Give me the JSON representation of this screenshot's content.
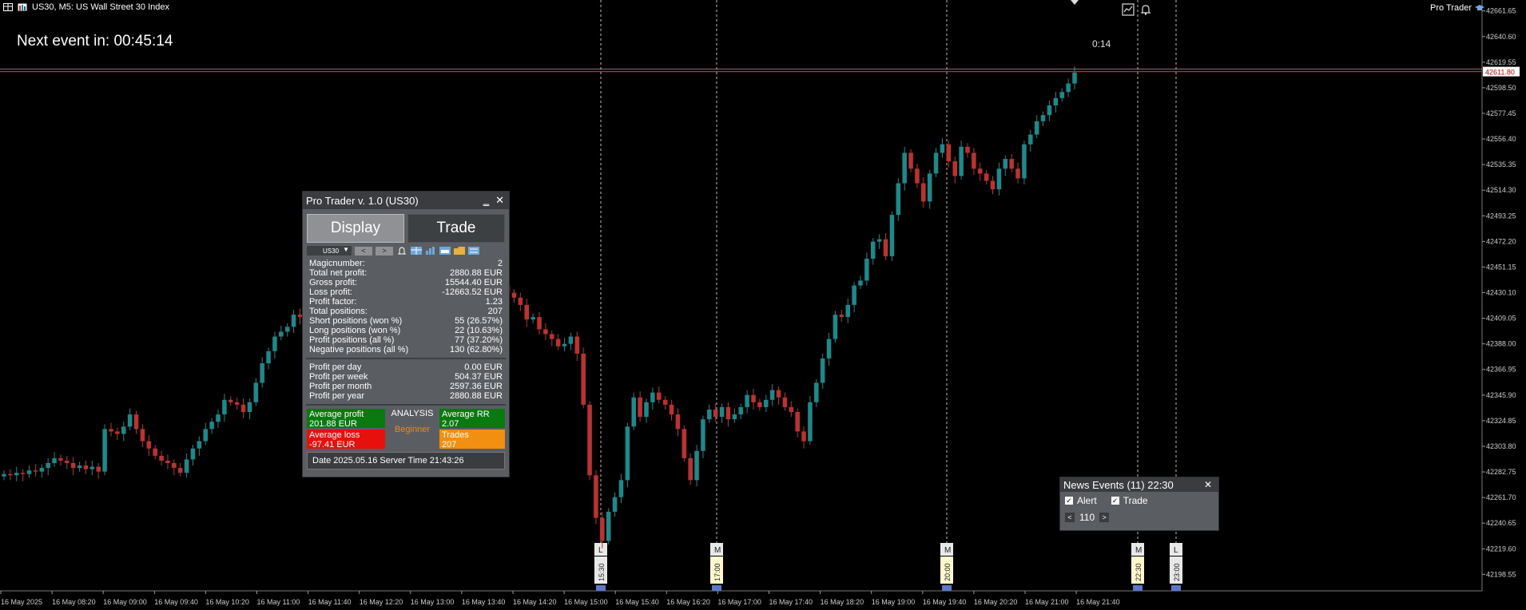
{
  "header": {
    "symbol_line": "US30, M5:  US Wall Street 30 Index",
    "brand": "Pro Trader",
    "next_event": "Next event in: 00:45:14",
    "countdown": "0:14"
  },
  "price_axis": {
    "labels": [
      "42661.65",
      "42640.60",
      "42619.55",
      "42598.50",
      "42577.45",
      "42556.40",
      "42535.35",
      "42514.30",
      "42493.25",
      "42472.20",
      "42451.15",
      "42430.10",
      "42409.05",
      "42388.00",
      "42366.95",
      "42345.90",
      "42324.85",
      "42303.80",
      "42282.75",
      "42261.70",
      "42240.65",
      "42219.60",
      "42198.55"
    ],
    "current_price": "42611.80",
    "current_price_color": "#e0202a"
  },
  "time_axis": {
    "labels": [
      "16 May 2025",
      "16 May 08:20",
      "16 May 09:00",
      "16 May 09:40",
      "16 May 10:20",
      "16 May 11:00",
      "16 May 11:40",
      "16 May 12:20",
      "16 May 13:00",
      "16 May 13:40",
      "16 May 14:20",
      "16 May 15:00",
      "16 May 15:40",
      "16 May 16:20",
      "16 May 17:00",
      "16 May 17:40",
      "16 May 18:20",
      "16 May 19:00",
      "16 May 19:40",
      "16 May 20:20",
      "16 May 21:00",
      "16 May 21:40"
    ]
  },
  "event_markers": [
    {
      "impact": "L",
      "time": "15:30"
    },
    {
      "impact": "M",
      "time": "17:00"
    },
    {
      "impact": "M",
      "time": "20:00"
    },
    {
      "impact": "M",
      "time": "22:30"
    },
    {
      "impact": "L",
      "time": "23:00"
    }
  ],
  "chart_data": {
    "type": "candlestick",
    "ylim": [
      42185,
      42668
    ],
    "colors": {
      "up": "#1a8a8a",
      "down": "#c03030"
    },
    "closes": [
      42281,
      42280,
      42282,
      42281,
      42284,
      42283,
      42286,
      42290,
      42294,
      42292,
      42290,
      42286,
      42288,
      42285,
      42287,
      42283,
      42318,
      42316,
      42314,
      42320,
      42330,
      42318,
      42308,
      42302,
      42296,
      42292,
      42290,
      42286,
      42282,
      42293,
      42302,
      42308,
      42318,
      42324,
      42330,
      42342,
      42340,
      42338,
      42332,
      42340,
      42356,
      42372,
      42382,
      42394,
      42398,
      42402,
      42412,
      42410,
      42415,
      42418,
      42414,
      42412,
      42420,
      42416,
      42424,
      42418,
      42420,
      42414,
      42418,
      42422,
      42419,
      42425,
      42424,
      42415,
      42418,
      42424,
      42430,
      42436,
      42438,
      42433,
      42438,
      42422,
      42415,
      42430,
      42438,
      42442,
      42446,
      42440,
      42432,
      42436,
      42430,
      42426,
      42420,
      42408,
      42410,
      42400,
      42396,
      42392,
      42386,
      42388,
      42394,
      42380,
      42338,
      42280,
      42245,
      42226,
      42250,
      42262,
      42276,
      42320,
      42344,
      42328,
      42340,
      42348,
      42342,
      42338,
      42330,
      42318,
      42294,
      42276,
      42300,
      42326,
      42334,
      42328,
      42336,
      42326,
      42330,
      42336,
      42346,
      42340,
      42336,
      42342,
      42350,
      42344,
      42336,
      42332,
      42316,
      42308,
      42340,
      42356,
      42376,
      42392,
      42412,
      42410,
      42420,
      42436,
      42440,
      42458,
      42472,
      42474,
      42460,
      42494,
      42520,
      42545,
      42532,
      42520,
      42505,
      42528,
      42545,
      42552,
      42538,
      42526,
      42550,
      42545,
      42532,
      42528,
      42522,
      42515,
      42532,
      42540,
      42532,
      42524,
      42552,
      42560,
      42571,
      42576,
      42584,
      42590,
      42595,
      42602,
      42611
    ]
  },
  "panel": {
    "title": "Pro Trader v. 1.0 (US30)",
    "tabs": {
      "display": "Display",
      "trade": "Trade"
    },
    "symbol": "US30",
    "stats": [
      {
        "label": "Magicnumber:",
        "value": "2"
      },
      {
        "label": "Total net profit:",
        "value": "2880.88 EUR"
      },
      {
        "label": "Gross profit:",
        "value": "15544.40 EUR"
      },
      {
        "label": "Loss profit:",
        "value": "-12663.52 EUR"
      },
      {
        "label": "Profit factor:",
        "value": "1.23"
      },
      {
        "label": "Total positions:",
        "value": "207"
      },
      {
        "label": "Short positions (won %)",
        "value": "55 (26.57%)"
      },
      {
        "label": "Long positions  (won %)",
        "value": "22 (10.63%)"
      },
      {
        "label": "Profit positions (all %)",
        "value": "77 (37.20%)"
      },
      {
        "label": "Negative positions (all %)",
        "value": "130 (62.80%)"
      }
    ],
    "period": [
      {
        "label": "Profit per day",
        "value": "0.00 EUR"
      },
      {
        "label": "Profit per week",
        "value": "504.37 EUR"
      },
      {
        "label": "Profit per month",
        "value": "2597.36 EUR"
      },
      {
        "label": "Profit per year",
        "value": "2880.88 EUR"
      }
    ],
    "analysis": {
      "avg_profit_label": "Average profit",
      "avg_profit_value": "201.88 EUR",
      "title": "ANALYSIS",
      "level": "Beginner",
      "avg_rr_label": "Average RR",
      "avg_rr_value": "2.07",
      "avg_loss_label": "Average loss",
      "avg_loss_value": "-97.41 EUR",
      "trades_label": "Trades",
      "trades_value": "207"
    },
    "footer": "Date 2025.05.16 Server Time 21:43:26"
  },
  "news": {
    "title": "News Events (11) 22:30",
    "alert_label": "Alert",
    "trade_label": "Trade",
    "count": "110"
  }
}
